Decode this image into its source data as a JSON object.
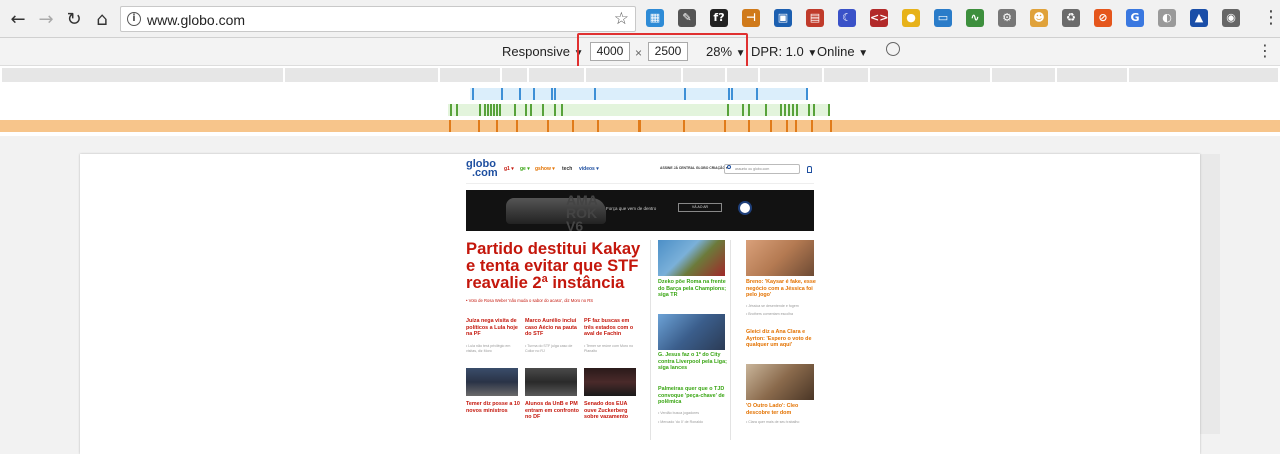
{
  "browser": {
    "url": "www.globo.com",
    "back": "←",
    "forward": "→",
    "reload": "↻",
    "home": "⌂",
    "info": "i",
    "star": "☆",
    "menu": "⋮",
    "extensions": [
      {
        "icon": "screen-ext-icon",
        "glyph": "▦",
        "color": "#2e8bd6"
      },
      {
        "icon": "eyedropper-ext-icon",
        "glyph": "✎",
        "color": "#555555"
      },
      {
        "icon": "font-ext-icon",
        "glyph": "f?",
        "color": "#222222"
      },
      {
        "icon": "ruler-ext-icon",
        "glyph": "⊣",
        "color": "#d07a1a"
      },
      {
        "icon": "clipboard-ext-icon",
        "glyph": "▣",
        "color": "#1c5fb0"
      },
      {
        "icon": "calendar-ext-icon",
        "glyph": "▤",
        "color": "#c03b2b"
      },
      {
        "icon": "moon-ext-icon",
        "glyph": "☾",
        "color": "#3a52c8"
      },
      {
        "icon": "code-ext-icon",
        "glyph": "<>",
        "color": "#b22a2a"
      },
      {
        "icon": "coin-ext-icon",
        "glyph": "●",
        "color": "#e7b21a"
      },
      {
        "icon": "folder-ext-icon",
        "glyph": "▭",
        "color": "#2a7cc9"
      },
      {
        "icon": "chart-ext-icon",
        "glyph": "∿",
        "color": "#3d8f3d"
      },
      {
        "icon": "gear-ext-icon",
        "glyph": "⚙",
        "color": "#777777"
      },
      {
        "icon": "face-ext-icon",
        "glyph": "☻",
        "color": "#e0a23a"
      },
      {
        "icon": "recycle-ext-icon",
        "glyph": "♻",
        "color": "#6b6b6b"
      },
      {
        "icon": "block-ext-icon",
        "glyph": "⊘",
        "color": "#e5561c"
      },
      {
        "icon": "translate-ext-icon",
        "glyph": "G",
        "color": "#3a78e0"
      },
      {
        "icon": "palette-ext-icon",
        "glyph": "◐",
        "color": "#9a9a9a"
      },
      {
        "icon": "warning-ext-icon",
        "glyph": "▲",
        "color": "#1a4ea8"
      },
      {
        "icon": "globe-ext-icon",
        "glyph": "◉",
        "color": "#666666"
      }
    ]
  },
  "devtools": {
    "device": "Responsive",
    "width": "4000",
    "times": "×",
    "height": "2500",
    "zoom": "28%",
    "dpr": "DPR: 1.0",
    "network": "Online",
    "caret": "▼",
    "rotate": "⃠"
  },
  "page": {
    "logo_line1": "globo",
    "logo_line2": ".com",
    "nav": [
      "g1 ▾",
      "ge ▾",
      "gshow ▾",
      "tech",
      "vídeos ▾"
    ],
    "top_links": "ASSINE JÁ     CENTRAL GLOBO     CRIAÇÃO ▾",
    "search_placeholder": "assunto ou globo.com",
    "ad_text": "Força que vem de dentro",
    "ad_cta": "VÁ AO AR",
    "headline": "Partido destitui Kakay e tenta evitar que STF reavalie 2ª instância",
    "headline_sub": "• Voto de Rosa Weber 'não muda o sabor do acaso', diz Moro no RS",
    "col1": [
      {
        "title": "Juíza nega visita de políticos a Lula hoje na PF",
        "sub": "• Lula não terá privilégio em visitas, diz Moro"
      },
      {
        "title": "Marco Aurélio inclui caso Aécio na pauta do STF",
        "sub": "• Turma do STF julga caso de Collor no RJ"
      },
      {
        "title": "PF faz buscas em três estados com o aval de Fachin",
        "sub": "• Temer se reúne com Moro no Planalto"
      }
    ],
    "col1b": [
      {
        "title": "Temer diz posse a 10 novos ministros"
      },
      {
        "title": "Alunos da UnB e PM entram em confronto no DF"
      },
      {
        "title": "Senado dos EUA ouve Zuckerberg sobre vazamento"
      }
    ],
    "mid": [
      {
        "title": "Dzeko põe Roma na frente do Barça pela Champions; siga TR"
      },
      {
        "title": "G. Jesus faz o 1º do City contra Liverpool pela Liga; siga lances"
      },
      {
        "title": "Palmeiras quer que o TJD convoque 'peça-chave' de polêmica",
        "sub": "• Verdão busca jogadores",
        "sub2": "• Mercado 'do 0' de Ronaldo"
      }
    ],
    "right": [
      {
        "title": "Breno: 'Kaysar é fake, esse negócio com a Jéssica foi pelo jogo'",
        "sub": "• Jéssica se desentende e fogem",
        "sub2": "• Brothers comentam escolha"
      },
      {
        "title": "Gleici diz a Ana Clara e Ayrton: 'Espero o voto de qualquer um aqui'"
      },
      {
        "title": "'O Outro Lado': Cleo descobre ter dom",
        "sub": "• Clara quer mais de seu trabalho"
      }
    ]
  }
}
